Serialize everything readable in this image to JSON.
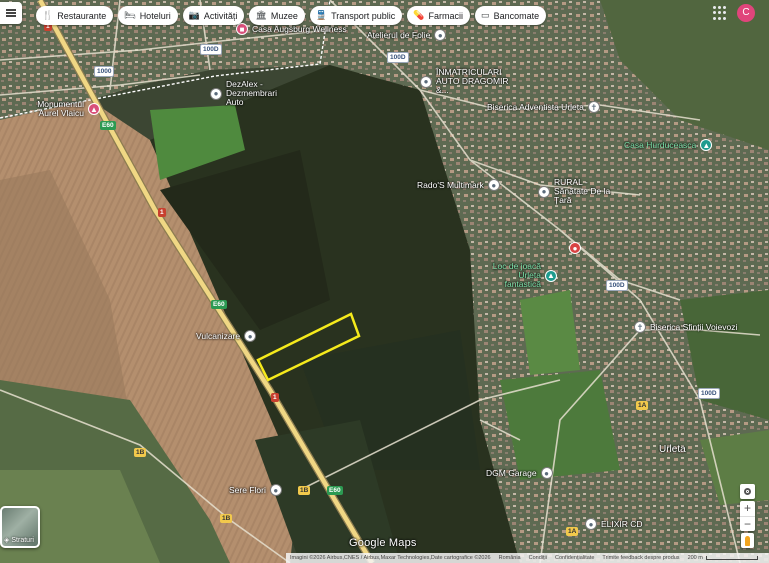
{
  "top_bar": {
    "chips": [
      {
        "label": "Restaurante",
        "icon": "fork-knife-icon",
        "glyph": "🍴"
      },
      {
        "label": "Hoteluri",
        "icon": "bed-icon",
        "glyph": "🛏"
      },
      {
        "label": "Activități",
        "icon": "camera-icon",
        "glyph": "📷"
      },
      {
        "label": "Muzee",
        "icon": "museum-icon",
        "glyph": "🏛"
      },
      {
        "label": "Transport public",
        "icon": "train-icon",
        "glyph": "🚆"
      },
      {
        "label": "Farmacii",
        "icon": "pharmacy-icon",
        "glyph": "💊"
      },
      {
        "label": "Bancomate",
        "icon": "atm-icon",
        "glyph": "▭"
      }
    ],
    "avatar_letter": "C",
    "avatar_color": "#e0457b"
  },
  "places": [
    {
      "label": "Casa Augsburg Wellness",
      "type": "hotel"
    },
    {
      "label": "Atelierul de Folie",
      "type": "poi"
    },
    {
      "label": "ÎNMATRICULARI AUTO DRAGOMIR &...",
      "type": "poi"
    },
    {
      "label": "Monumentul Aurel Vlaicu",
      "type": "museum"
    },
    {
      "label": "DezAlex - Dezmembrari Auto",
      "type": "poi"
    },
    {
      "label": "Biserica Adventista Urleta",
      "type": "church"
    },
    {
      "label": "Casa Hurduceasca",
      "type": "park"
    },
    {
      "label": "Rado'S Multimark",
      "type": "shop"
    },
    {
      "label": "RURAL - Sănătate De la Țară",
      "type": "shop"
    },
    {
      "label": "Loc de joacă Urleta fantastică",
      "type": "park"
    },
    {
      "label": "Biserica Sfinții Voievozi",
      "type": "church"
    },
    {
      "label": "Vulcanizare",
      "type": "poi"
    },
    {
      "label": "DGM Garage",
      "type": "poi"
    },
    {
      "label": "Sere Flori",
      "type": "poi"
    },
    {
      "label": "ELIXIR CD",
      "type": "poi"
    }
  ],
  "locality_label": "Urleta",
  "road_numbers": [
    "1",
    "1",
    "1",
    "E60",
    "E60",
    "E60",
    "1000",
    "100D",
    "100D",
    "100D",
    "100D",
    "1B",
    "1B",
    "1B",
    "1A",
    "1A"
  ],
  "layers": {
    "label": "Straturi"
  },
  "brand": "Google Maps",
  "footer": {
    "attribution": "Imagini ©2026 Airbus,CNES / Airbus,Maxar Technologies,Date cartografice ©2026",
    "links": [
      "România",
      "Condiții",
      "Confidențialitate",
      "Trimite feedback despre produs"
    ],
    "scale_label": "200 m"
  },
  "colors": {
    "highlight_polygon": "#f5ea1c",
    "main_road": "#f0d784",
    "boundary": "#ffffff"
  }
}
